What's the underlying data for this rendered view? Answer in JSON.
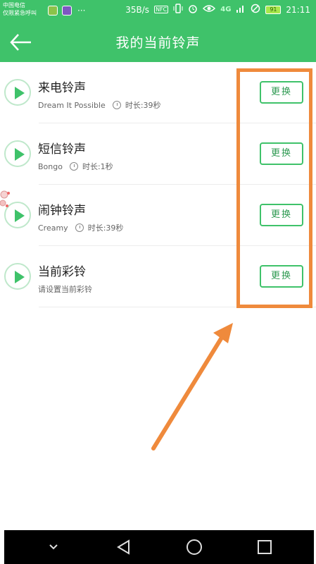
{
  "status_bar": {
    "carrier_line1": "中国电信",
    "carrier_line2": "仅限紧急呼叫",
    "more": "···",
    "speed": "35B/s",
    "nfc": "NFC",
    "network": "4G",
    "battery": "91",
    "time": "21:11"
  },
  "header": {
    "title": "我的当前铃声"
  },
  "ringtones": [
    {
      "title": "来电铃声",
      "subtitle": "Dream It Possible",
      "duration": "时长:39秒",
      "button": "更换"
    },
    {
      "title": "短信铃声",
      "subtitle": "Bongo",
      "duration": "时长:1秒",
      "button": "更换"
    },
    {
      "title": "闹钟铃声",
      "subtitle": "Creamy",
      "duration": "时长:39秒",
      "button": "更换"
    },
    {
      "title": "当前彩铃",
      "subtitle": "请设置当前彩铃",
      "duration": "",
      "button": "更换"
    }
  ],
  "colors": {
    "primary": "#3fc26a",
    "annotation": "#ef8a3c"
  }
}
